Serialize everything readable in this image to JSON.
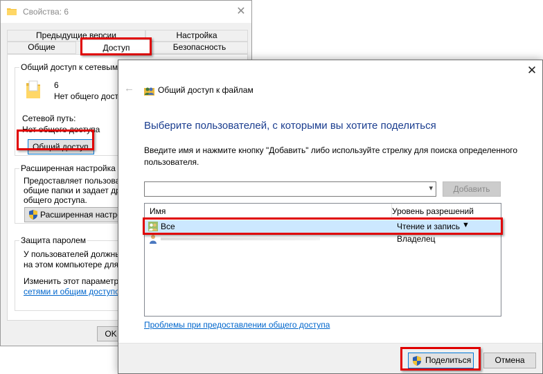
{
  "props_window": {
    "title": "Свойства: 6",
    "tabs_top": [
      "Предыдущие версии",
      "Настройка"
    ],
    "tabs_bottom": [
      "Общие",
      "Доступ",
      "Безопасность"
    ],
    "share_group": {
      "title": "Общий доступ к сетевым фай",
      "item_name": "6",
      "item_status": "Нет общего доступ",
      "net_path_label": "Сетевой путь:",
      "net_path_value": "Нет общего доступа",
      "share_button": "Общий доступ..."
    },
    "advanced_group": {
      "title": "Расширенная настройка об",
      "desc_line1": "Предоставляет пользовате",
      "desc_line2": "общие папки и задает друг",
      "desc_line3": "общего доступа.",
      "button": "Расширенная настрой"
    },
    "password_group": {
      "title": "Защита паролем",
      "desc_line1": "У пользователей должны б",
      "desc_line2": "на этом компьютере для до",
      "change_line": "Изменить этот параметр м",
      "link": "сетями и общим доступом."
    },
    "ok_button": "OK"
  },
  "dialog": {
    "title": "Общий доступ к файлам",
    "heading": "Выберите пользователей, с которыми вы хотите поделиться",
    "instruction": "Введите имя и нажмите кнопку \"Добавить\" либо используйте стрелку для поиска определенного пользователя.",
    "input_value": "",
    "add_button": "Добавить",
    "columns": {
      "name": "Имя",
      "permission": "Уровень разрешений"
    },
    "rows": [
      {
        "name": "Все",
        "permission": "Чтение и запись",
        "selected": true
      },
      {
        "name": "",
        "permission": "Владелец",
        "selected": false
      }
    ],
    "problems_link": "Проблемы при предоставлении общего доступа",
    "share_button": "Поделиться",
    "cancel_button": "Отмена"
  },
  "colors": {
    "highlight_red": "#e00000",
    "heading_blue": "#1a3d8f",
    "link_blue": "#0066cc",
    "selection": "#cce8ff"
  },
  "icons": {
    "folder": "folder-icon",
    "users": "users-icon",
    "user": "user-icon",
    "shield": "uac-shield-icon",
    "close": "close-icon",
    "back": "back-arrow-icon",
    "dropdown": "chevron-down-icon"
  }
}
